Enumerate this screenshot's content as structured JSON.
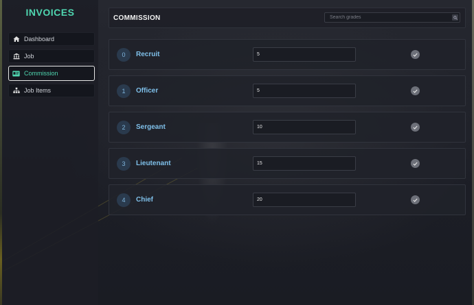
{
  "sidebar": {
    "brand": "INVOICES",
    "items": [
      {
        "label": "Dashboard",
        "icon": "home-icon"
      },
      {
        "label": "Job",
        "icon": "building-icon"
      },
      {
        "label": "Commission",
        "icon": "id-card-icon",
        "active": true
      },
      {
        "label": "Job Items",
        "icon": "sitemap-icon"
      }
    ]
  },
  "header": {
    "title": "COMMISSION",
    "search_placeholder": "Search grades",
    "search_icon": "search-icon"
  },
  "grades": [
    {
      "index": "0",
      "name": "Recruit",
      "commission": "5"
    },
    {
      "index": "1",
      "name": "Officer",
      "commission": "5"
    },
    {
      "index": "2",
      "name": "Sergeant",
      "commission": "10"
    },
    {
      "index": "3",
      "name": "Lieutenant",
      "commission": "15"
    },
    {
      "index": "4",
      "name": "Chief",
      "commission": "20"
    }
  ],
  "colors": {
    "accent": "#4fd6b0",
    "grade_text": "#7fc0ea",
    "background": "#1e2029"
  }
}
